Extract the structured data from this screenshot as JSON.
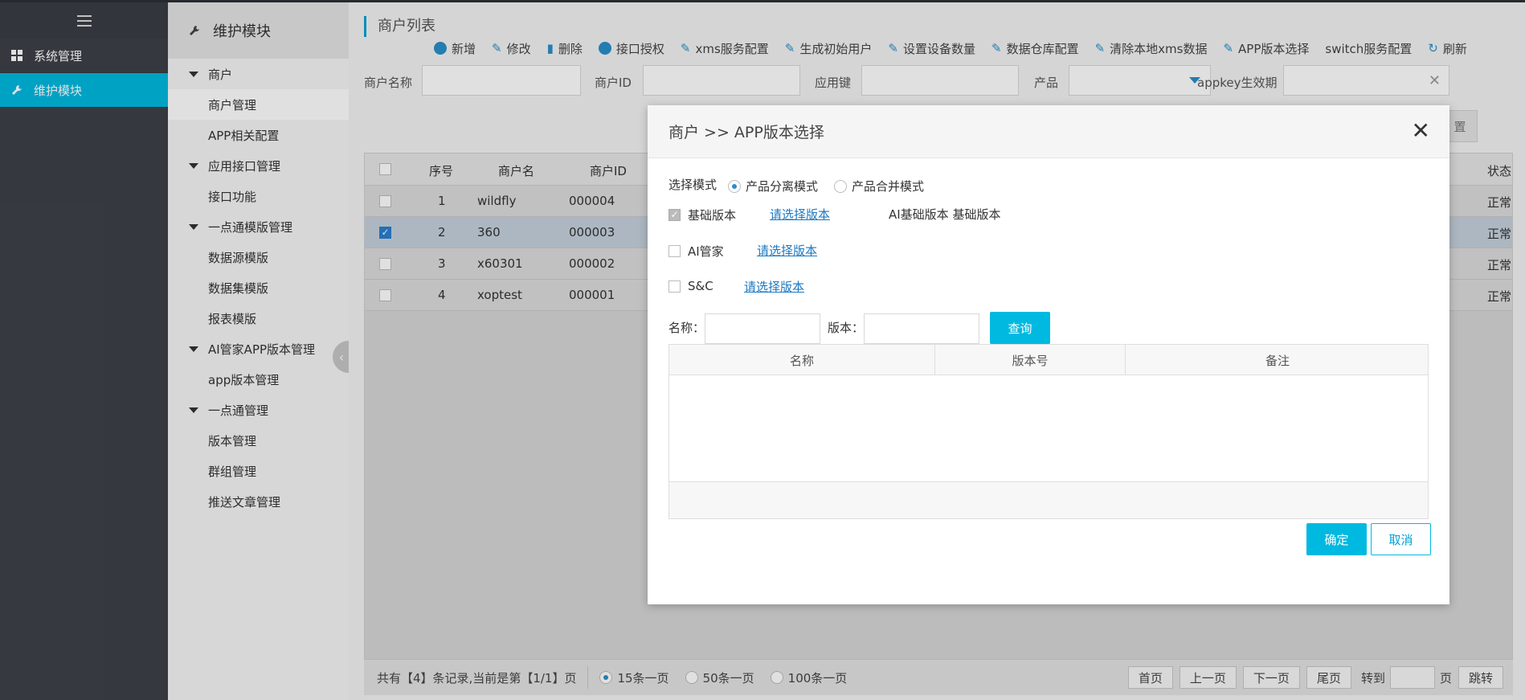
{
  "sidebar": {
    "items": [
      {
        "label": "系统管理",
        "icon": "grid-icon"
      },
      {
        "label": "维护模块",
        "icon": "wrench-icon"
      }
    ]
  },
  "subnav": {
    "title": "维护模块",
    "groups": [
      {
        "label": "商户",
        "items": [
          "商户管理",
          "APP相关配置"
        ]
      },
      {
        "label": "应用接口管理",
        "items": [
          "接口功能"
        ]
      },
      {
        "label": "一点通模版管理",
        "items": [
          "数据源模版",
          "数据集模版",
          "报表模版"
        ]
      },
      {
        "label": "AI管家APP版本管理",
        "items": [
          "app版本管理"
        ]
      },
      {
        "label": "一点通管理",
        "items": [
          "版本管理",
          "群组管理",
          "推送文章管理"
        ]
      }
    ]
  },
  "page": {
    "title": "商户列表"
  },
  "toolbar": {
    "buttons": [
      "新增",
      "修改",
      "删除",
      "接口授权",
      "xms服务配置",
      "生成初始用户",
      "设置设备数量",
      "数据仓库配置",
      "清除本地xms数据",
      "APP版本选择",
      "switch服务配置",
      "刷新"
    ]
  },
  "filters": {
    "merchant_name": "商户名称",
    "merchant_id": "商户ID",
    "app_key": "应用键",
    "product": "产品",
    "appkey_valid": "appkey生效期"
  },
  "grid": {
    "headers": {
      "seq": "序号",
      "name": "商户名",
      "id": "商户ID",
      "status": "状态"
    },
    "rows": [
      {
        "seq": "1",
        "name": "wildfly",
        "id": "000004",
        "status": "正常"
      },
      {
        "seq": "2",
        "name": "360",
        "id": "000003",
        "status": "正常"
      },
      {
        "seq": "3",
        "name": "x60301",
        "id": "000002",
        "status": "正常"
      },
      {
        "seq": "4",
        "name": "xoptest",
        "id": "000001",
        "status": "正常"
      }
    ],
    "partial_button": "置"
  },
  "pager": {
    "summary": "共有【4】条记录,当前是第【1/1】页",
    "sizes": [
      "15条一页",
      "50条一页",
      "100条一页"
    ],
    "buttons": [
      "首页",
      "上一页",
      "下一页",
      "尾页"
    ],
    "goto": "转到",
    "page_unit": "页",
    "jump": "跳转"
  },
  "dialog": {
    "title": "商户 >> APP版本选择",
    "mode_label": "选择模式",
    "mode_options": [
      "产品分离模式",
      "产品合并模式"
    ],
    "products": [
      {
        "label": "基础版本",
        "link": "请选择版本",
        "selected": "AI基础版本 基础版本"
      },
      {
        "label": "AI管家",
        "link": "请选择版本",
        "selected": ""
      },
      {
        "label": "S&C",
        "link": "请选择版本",
        "selected": ""
      }
    ],
    "search_name_label": "名称：",
    "search_version_label": "版本：",
    "query_button": "查询",
    "table_headers": [
      "名称",
      "版本号",
      "备注"
    ],
    "confirm": "确定",
    "cancel": "取消"
  }
}
